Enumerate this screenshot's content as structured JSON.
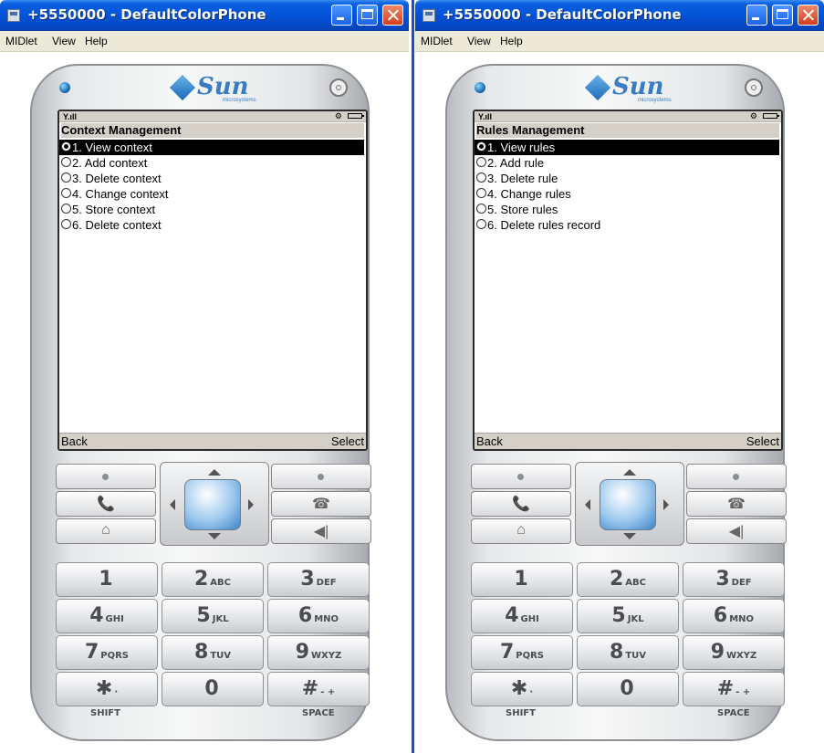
{
  "windows": [
    {
      "title": "+5550000 - DefaultColorPhone",
      "menu": [
        "MIDlet",
        "View",
        "Help"
      ],
      "logo": {
        "text": "Sun",
        "sub": "microsystems"
      },
      "screen": {
        "title": "Context Management",
        "items": [
          "1. View context",
          "2. Add context",
          "3. Delete context",
          "4. Change context",
          "5. Store context",
          "6. Delete context"
        ],
        "selected_index": 0,
        "soft_left": "Back",
        "soft_right": "Select"
      }
    },
    {
      "title": "+5550000 - DefaultColorPhone",
      "menu": [
        "MIDlet",
        "View",
        "Help"
      ],
      "logo": {
        "text": "Sun",
        "sub": "microsystems"
      },
      "screen": {
        "title": "Rules Management",
        "items": [
          "1. View rules",
          "2. Add rule",
          "3. Delete rule",
          "4. Change rules",
          "5. Store rules",
          "6. Delete rules record"
        ],
        "selected_index": 0,
        "soft_left": "Back",
        "soft_right": "Select"
      }
    }
  ],
  "keypad": {
    "keys": [
      {
        "num": "1",
        "letters": ""
      },
      {
        "num": "2",
        "letters": "ABC"
      },
      {
        "num": "3",
        "letters": "DEF"
      },
      {
        "num": "4",
        "letters": "GHI"
      },
      {
        "num": "5",
        "letters": "JKL"
      },
      {
        "num": "6",
        "letters": "MNO"
      },
      {
        "num": "7",
        "letters": "PQRS"
      },
      {
        "num": "8",
        "letters": "TUV"
      },
      {
        "num": "9",
        "letters": "WXYZ"
      },
      {
        "num": "✱",
        "letters": "·"
      },
      {
        "num": "0",
        "letters": ""
      },
      {
        "num": "#",
        "letters": "- +"
      }
    ],
    "shift_label": "SHIFT",
    "space_label": "SPACE"
  },
  "colors": {
    "titlebar": "#0453d6",
    "select_highlight": "#000000",
    "screen_bar": "#d4d0c8"
  }
}
